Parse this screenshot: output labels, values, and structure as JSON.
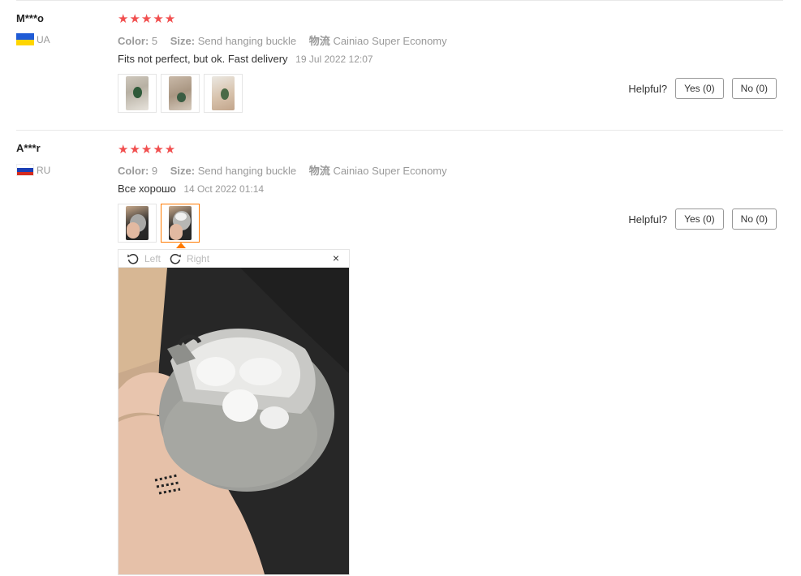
{
  "reviews": [
    {
      "user": "M***o",
      "country": "UA",
      "flag_colors": [
        "#1f5bd6",
        "#ffd500"
      ],
      "stars": "★★★★★",
      "color_label": "Color:",
      "color_value": "5",
      "size_label": "Size:",
      "size_value": "Send hanging buckle",
      "shipping_label": "物流",
      "shipping_value": "Cainiao Super Economy",
      "text": "Fits not perfect, but ok. Fast delivery",
      "date": "19 Jul 2022 12:07",
      "helpful_label": "Helpful?",
      "yes_label": "Yes (0)",
      "no_label": "No (0)"
    },
    {
      "user": "A***r",
      "country": "RU",
      "flag_colors": [
        "#ffffff",
        "#1c3fb5",
        "#d52b1e"
      ],
      "stars": "★★★★★",
      "color_label": "Color:",
      "color_value": "9",
      "size_label": "Size:",
      "size_value": "Send hanging buckle",
      "shipping_label": "物流",
      "shipping_value": "Cainiao Super Economy",
      "text": "Все хорошо",
      "date": "14 Oct 2022 01:14",
      "helpful_label": "Helpful?",
      "yes_label": "Yes (0)",
      "no_label": "No (0)"
    }
  ],
  "viewer": {
    "rotate_left_label": "Left",
    "rotate_right_label": "Right",
    "close_glyph": "×"
  },
  "colors": {
    "star": "#f14f4f",
    "active_thumb_border": "#ff7a00"
  }
}
